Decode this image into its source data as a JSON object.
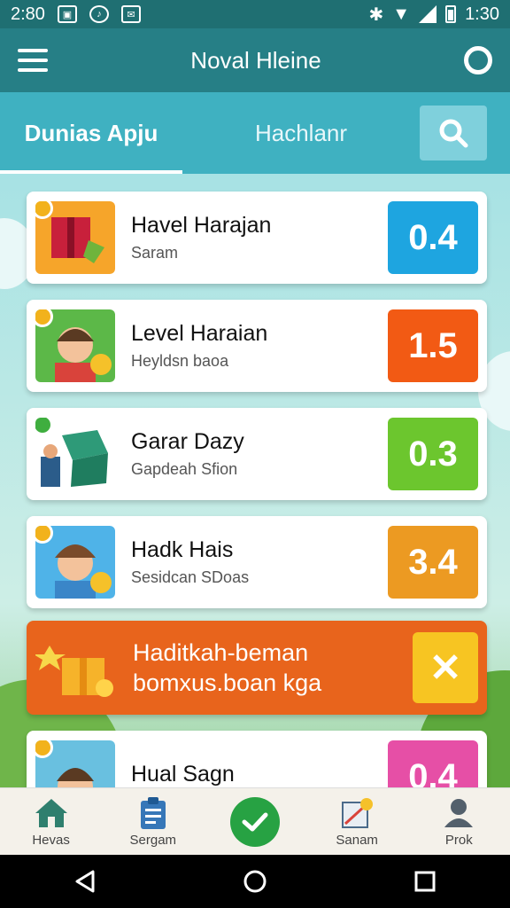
{
  "status_bar": {
    "time_left": "2:80",
    "time_right": "1:30"
  },
  "app_bar": {
    "title": "Noval Hleine"
  },
  "tabs": [
    {
      "label": "Dunias Apju"
    },
    {
      "label": "Hachlanr"
    }
  ],
  "cards": [
    {
      "title": "Havel Harajan",
      "subtitle": "Saram",
      "score": "0.4",
      "score_color": "#1ea5e0",
      "badge_color": "#f2b21c",
      "thumb_color": "#f6a52a",
      "thumb_icon": "gift-box-icon"
    },
    {
      "title": "Level Haraian",
      "subtitle": "Heyldsn baoa",
      "score": "1.5",
      "score_color": "#f25a14",
      "badge_color": "#f2b21c",
      "thumb_color": "#5cb848",
      "thumb_icon": "boy-avatar-icon"
    },
    {
      "title": "Garar Dazy",
      "subtitle": "Gapdeah Sfion",
      "score": "0.3",
      "score_color": "#6cc62e",
      "badge_color": "#3fae3f",
      "thumb_color": "#ffffff",
      "thumb_icon": "money-box-icon"
    },
    {
      "title": "Hadk Hais",
      "subtitle": "Sesidcan SDoas",
      "score": "3.4",
      "score_color": "#ec9a22",
      "badge_color": "#f2b21c",
      "thumb_color": "#4fb3e8",
      "thumb_icon": "boy-avatar-icon"
    },
    {
      "title": "Hual Sagn",
      "subtitle": "",
      "score": "0.4",
      "score_color": "#e64fa6",
      "badge_color": "#f2b21c",
      "thumb_color": "#69c0e0",
      "thumb_icon": "boy-avatar-icon"
    }
  ],
  "promo": {
    "line1": "Haditkah-beman",
    "line2": "bomxus.boan kga",
    "accent": "#e8641c"
  },
  "bottom_nav": [
    {
      "label": "Hevas",
      "icon": "home-icon"
    },
    {
      "label": "Sergam",
      "icon": "clipboard-icon"
    },
    {
      "label": "",
      "icon": "check-icon"
    },
    {
      "label": "Sanam",
      "icon": "map-icon"
    },
    {
      "label": "Prok",
      "icon": "profile-icon"
    }
  ]
}
